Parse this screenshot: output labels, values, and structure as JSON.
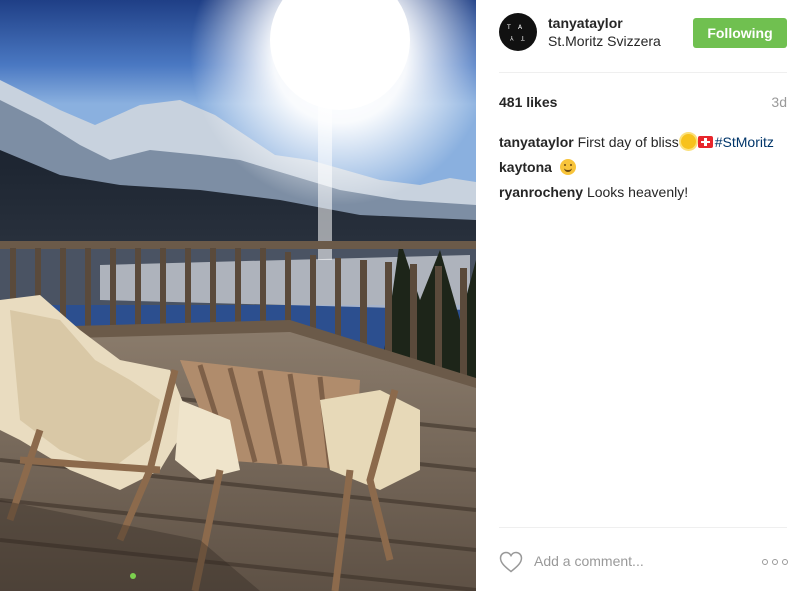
{
  "post": {
    "photo_icon": "photo-mountain-terrace",
    "photo_marker_color": "#7cd04e"
  },
  "header": {
    "avatar_icon": "tanya-taylor-monogram-logo",
    "username": "tanyataylor",
    "location": "St.Moritz Svizzera",
    "follow_label": "Following",
    "follow_color": "#70c050"
  },
  "meta": {
    "likes": "481 likes",
    "time": "3d"
  },
  "comments": [
    {
      "user": "tanyataylor",
      "text": "First day of bliss",
      "emoji": [
        "sun-emoji",
        "swiss-flag-emoji"
      ],
      "hashtag": "#StMoritz"
    },
    {
      "user": "kaytona",
      "text": "",
      "emoji": [
        "smiley-emoji"
      ]
    },
    {
      "user": "ryanrocheny",
      "text": "Looks heavenly!"
    }
  ],
  "footer": {
    "heart_icon": "heart-outline-icon",
    "comment_placeholder": "Add a comment...",
    "more_icon": "more-options-icon"
  }
}
